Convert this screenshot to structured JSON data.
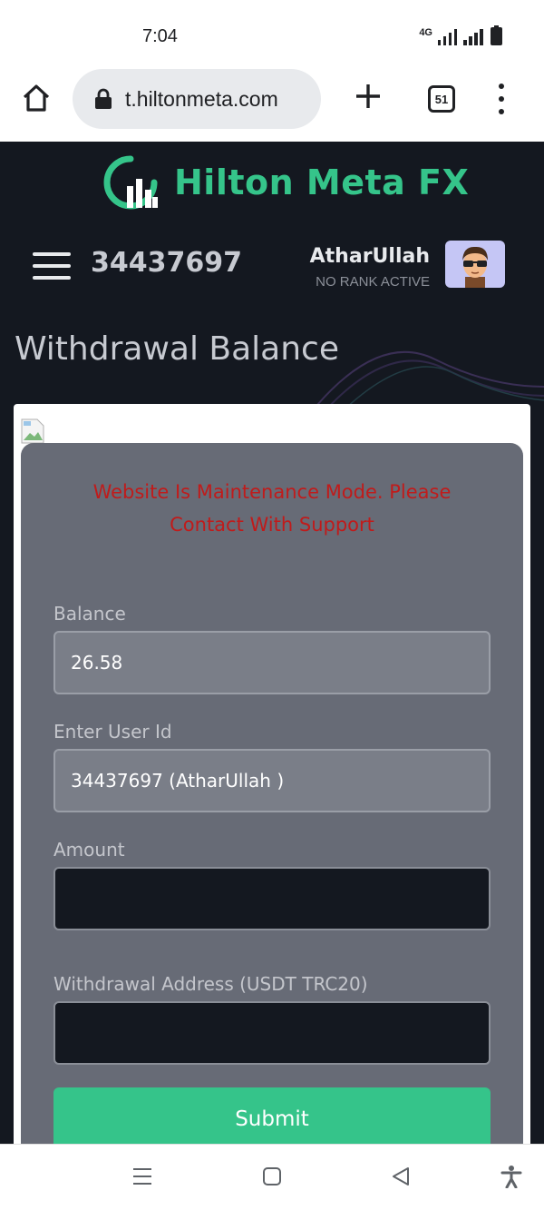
{
  "status_bar": {
    "time": "7:04",
    "network_label": "4G",
    "icons": [
      "signal-icon",
      "signal-icon",
      "battery-icon"
    ]
  },
  "browser": {
    "url": "t.hiltonmeta.com",
    "tab_count": "51",
    "icons": [
      "home-icon",
      "lock-icon",
      "plus-icon",
      "tabs-icon",
      "more-icon"
    ]
  },
  "site": {
    "brand": "Hilton Meta FX",
    "accent_color": "#35c48a",
    "user_id": "34437697",
    "user_name": "AtharUllah",
    "user_rank": "NO RANK ACTIVE"
  },
  "withdrawal": {
    "title": "Withdrawal Balance",
    "maintenance_line1": "Website Is Maintenance Mode. Please",
    "maintenance_line2": "Contact With Support",
    "maintenance_color": "#c01b1b",
    "balance_label": "Balance",
    "balance_value": "26.58",
    "user_id_label": "Enter User Id",
    "user_id_value": "34437697 (AtharUllah )",
    "amount_label": "Amount",
    "amount_value": "",
    "address_label": "Withdrawal Address (USDT TRC20)",
    "address_value": "",
    "submit_label": "Submit"
  },
  "nav_bar": {
    "icons": [
      "recent-apps-icon",
      "home-square-icon",
      "back-icon",
      "accessibility-icon"
    ]
  }
}
